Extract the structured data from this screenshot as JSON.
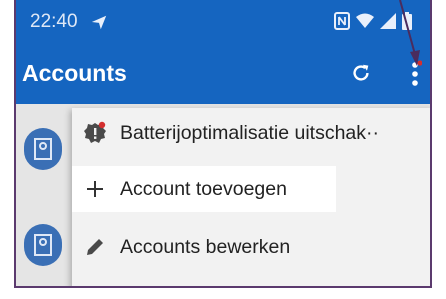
{
  "status_bar": {
    "time": "22:40",
    "icons": [
      "navigation-arrow-icon",
      "nfc-icon",
      "wifi-icon",
      "signal-icon",
      "battery-icon"
    ]
  },
  "app_bar": {
    "title": "Accounts",
    "actions": [
      "refresh-icon",
      "more-vert-icon"
    ]
  },
  "menu": {
    "items": [
      {
        "label": "Batterijoptimalisatie uitschak··",
        "icon": "settings-badge-icon"
      },
      {
        "label": "Account toevoegen",
        "icon": "plus-icon"
      },
      {
        "label": "Accounts bewerken",
        "icon": "pencil-icon"
      }
    ]
  },
  "colors": {
    "primary": "#1565c0",
    "badge": "#d32f2f",
    "annotation": "#4a2c5e"
  }
}
